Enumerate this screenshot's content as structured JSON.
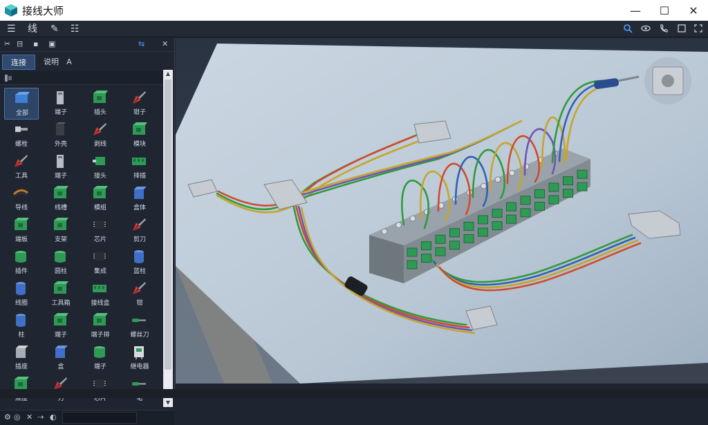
{
  "window": {
    "title": "接线大师",
    "controls": [
      "—",
      "☐",
      "✕"
    ]
  },
  "menubar": {
    "items": [
      "☰",
      "线",
      "✎",
      "☷"
    ],
    "right_tools": [
      "search-icon",
      "eye-icon",
      "phone-icon",
      "frame-icon",
      "fullscreen-icon"
    ]
  },
  "left_panel": {
    "toolbar_icons": [
      "✂",
      "⊟",
      "▪",
      "▣"
    ],
    "toolbar_right": [
      "⇆",
      "✕"
    ],
    "tabs": [
      {
        "label": "连接",
        "active": true
      },
      {
        "label": "说明",
        "active": false
      },
      {
        "label": "A",
        "active": false
      }
    ],
    "tiles": [
      {
        "label": "全部",
        "icon": "blue-block-icon",
        "selected": true
      },
      {
        "label": "端子",
        "icon": "gray-terminal-icon"
      },
      {
        "label": "插头",
        "icon": "green-block-icon"
      },
      {
        "label": "钳子",
        "icon": "pliers-icon"
      },
      {
        "label": "螺栓",
        "icon": "bolt-icon"
      },
      {
        "label": "外壳",
        "icon": "dark-block-icon"
      },
      {
        "label": "剥线",
        "icon": "pliers-icon"
      },
      {
        "label": "模块",
        "icon": "green-block-icon"
      },
      {
        "label": "工具",
        "icon": "pliers-icon"
      },
      {
        "label": "端子",
        "icon": "gray-terminal-icon"
      },
      {
        "label": "接头",
        "icon": "green-plug-icon"
      },
      {
        "label": "排插",
        "icon": "green-strip-icon"
      },
      {
        "label": "导线",
        "icon": "wire-icon"
      },
      {
        "label": "线槽",
        "icon": "green-block-icon"
      },
      {
        "label": "模组",
        "icon": "green-block-icon"
      },
      {
        "label": "盒体",
        "icon": "blue-cube-icon"
      },
      {
        "label": "端板",
        "icon": "green-block-icon"
      },
      {
        "label": "支架",
        "icon": "green-block-icon"
      },
      {
        "label": "芯片",
        "icon": "chip-icon"
      },
      {
        "label": "剪刀",
        "icon": "pliers-icon"
      },
      {
        "label": "插件",
        "icon": "green-cylinder-icon"
      },
      {
        "label": "圆柱",
        "icon": "green-cylinder-icon"
      },
      {
        "label": "集成",
        "icon": "chip-icon"
      },
      {
        "label": "蓝柱",
        "icon": "blue-cylinder-icon"
      },
      {
        "label": "线圈",
        "icon": "blue-cylinder-icon"
      },
      {
        "label": "工具箱",
        "icon": "green-block-icon"
      },
      {
        "label": "接线盒",
        "icon": "green-strip-icon"
      },
      {
        "label": "钳",
        "icon": "pliers-icon"
      },
      {
        "label": "柱",
        "icon": "blue-cylinder-icon"
      },
      {
        "label": "端子",
        "icon": "green-block-icon"
      },
      {
        "label": "端子排",
        "icon": "green-block-icon"
      },
      {
        "label": "螺丝刀",
        "icon": "screwdriver-icon"
      },
      {
        "label": "插座",
        "icon": "gray-cube-icon"
      },
      {
        "label": "盒",
        "icon": "blue-cube-icon"
      },
      {
        "label": "端子",
        "icon": "green-cylinder-icon"
      },
      {
        "label": "继电器",
        "icon": "relay-icon"
      },
      {
        "label": "底座",
        "icon": "green-block-icon"
      },
      {
        "label": "刀",
        "icon": "pliers-icon"
      },
      {
        "label": "芯片",
        "icon": "chip-icon"
      },
      {
        "label": "笔",
        "icon": "screwdriver-icon"
      }
    ],
    "bottom_icons": [
      "⚙",
      "◎",
      "✕",
      "⇢",
      "◐"
    ]
  },
  "colors": {
    "accent": "#4aa3ff",
    "panel_bg": "#1f2631",
    "terminal_green": "#2f9a55",
    "board": "#b8c7d6"
  }
}
